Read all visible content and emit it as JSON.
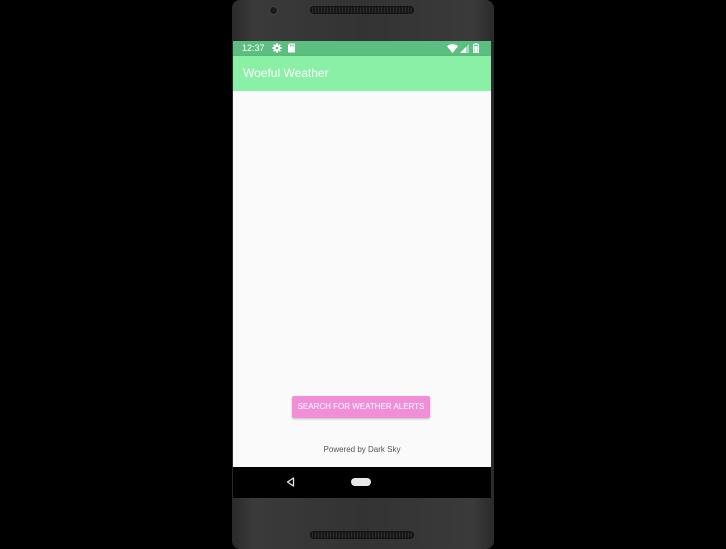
{
  "status_bar": {
    "time": "12:37",
    "icons": [
      "gear-icon",
      "sd-card-icon",
      "wifi-icon",
      "signal-icon",
      "battery-icon"
    ],
    "color": "#5cbf81"
  },
  "app_bar": {
    "title": "Woeful Weather",
    "color": "#8af0a6"
  },
  "main": {
    "search_button_label": "SEARCH FOR WEATHER ALERTS",
    "search_button_color": "#f08fd8",
    "powered_by": "Powered by Dark Sky"
  },
  "nav_bar": {
    "icons": [
      "back-icon",
      "home-icon"
    ]
  }
}
